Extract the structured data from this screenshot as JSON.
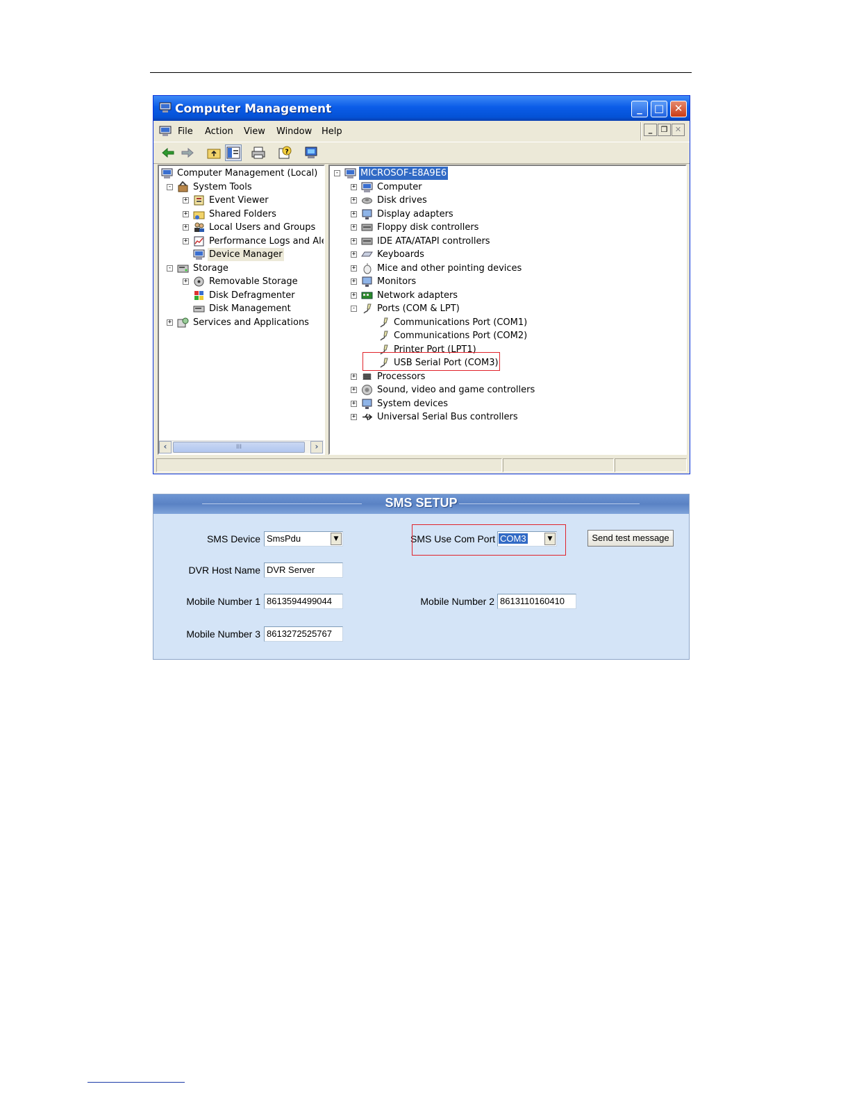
{
  "window": {
    "title": "Computer Management",
    "menu": [
      "File",
      "Action",
      "View",
      "Window",
      "Help"
    ],
    "title_buttons": {
      "minimize": "_",
      "maximize": "□",
      "close": "✕"
    },
    "mdi_buttons": {
      "minimize": "_",
      "restore": "❐",
      "close": "✕"
    },
    "scroll_thumb": "III"
  },
  "left_tree": [
    {
      "label": "Computer Management (Local)",
      "icon": "computer-management-icon",
      "level": 0,
      "expander": ""
    },
    {
      "label": "System Tools",
      "icon": "system-tools-icon",
      "level": 1,
      "expander": "-"
    },
    {
      "label": "Event Viewer",
      "icon": "event-viewer-icon",
      "level": 2,
      "expander": "+"
    },
    {
      "label": "Shared Folders",
      "icon": "shared-folders-icon",
      "level": 2,
      "expander": "+"
    },
    {
      "label": "Local Users and Groups",
      "icon": "users-icon",
      "level": 2,
      "expander": "+"
    },
    {
      "label": "Performance Logs and Alerts",
      "icon": "performance-icon",
      "level": 2,
      "expander": "+"
    },
    {
      "label": "Device Manager",
      "icon": "device-manager-icon",
      "level": 2,
      "expander": "",
      "highlight": true
    },
    {
      "label": "Storage",
      "icon": "storage-icon",
      "level": 1,
      "expander": "-"
    },
    {
      "label": "Removable Storage",
      "icon": "removable-storage-icon",
      "level": 2,
      "expander": "+"
    },
    {
      "label": "Disk Defragmenter",
      "icon": "defragmenter-icon",
      "level": 2,
      "expander": ""
    },
    {
      "label": "Disk Management",
      "icon": "disk-management-icon",
      "level": 2,
      "expander": ""
    },
    {
      "label": "Services and Applications",
      "icon": "services-icon",
      "level": 1,
      "expander": "+"
    }
  ],
  "right_tree": [
    {
      "label": "MICROSOF-E8A9E6",
      "icon": "computer-icon",
      "level": 0,
      "expander": "-",
      "selected": true
    },
    {
      "label": "Computer",
      "icon": "computer-icon",
      "level": 1,
      "expander": "+"
    },
    {
      "label": "Disk drives",
      "icon": "disk-drive-icon",
      "level": 1,
      "expander": "+"
    },
    {
      "label": "Display adapters",
      "icon": "display-adapter-icon",
      "level": 1,
      "expander": "+"
    },
    {
      "label": "Floppy disk controllers",
      "icon": "floppy-controller-icon",
      "level": 1,
      "expander": "+"
    },
    {
      "label": "IDE ATA/ATAPI controllers",
      "icon": "ide-controller-icon",
      "level": 1,
      "expander": "+"
    },
    {
      "label": "Keyboards",
      "icon": "keyboard-icon",
      "level": 1,
      "expander": "+"
    },
    {
      "label": "Mice and other pointing devices",
      "icon": "mouse-icon",
      "level": 1,
      "expander": "+"
    },
    {
      "label": "Monitors",
      "icon": "monitor-icon",
      "level": 1,
      "expander": "+"
    },
    {
      "label": "Network adapters",
      "icon": "network-adapter-icon",
      "level": 1,
      "expander": "+"
    },
    {
      "label": "Ports (COM & LPT)",
      "icon": "port-icon",
      "level": 1,
      "expander": "-"
    },
    {
      "label": "Communications Port (COM1)",
      "icon": "port-icon",
      "level": 2,
      "expander": ""
    },
    {
      "label": "Communications Port (COM2)",
      "icon": "port-icon",
      "level": 2,
      "expander": ""
    },
    {
      "label": "Printer Port (LPT1)",
      "icon": "port-icon",
      "level": 2,
      "expander": ""
    },
    {
      "label": "USB Serial Port (COM3)",
      "icon": "port-icon",
      "level": 2,
      "expander": "",
      "boxed": true
    },
    {
      "label": "Processors",
      "icon": "processor-icon",
      "level": 1,
      "expander": "+"
    },
    {
      "label": "Sound, video and game controllers",
      "icon": "sound-icon",
      "level": 1,
      "expander": "+"
    },
    {
      "label": "System devices",
      "icon": "system-devices-icon",
      "level": 1,
      "expander": "+"
    },
    {
      "label": "Universal Serial Bus controllers",
      "icon": "usb-icon",
      "level": 1,
      "expander": "+"
    }
  ],
  "sms": {
    "title": "SMS SETUP",
    "device_label": "SMS Device",
    "device_value": "SmsPdu",
    "com_label": "SMS Use Com Port",
    "com_value": "COM3",
    "test_button": "Send test message",
    "host_label": "DVR Host Name",
    "host_value": "DVR Server",
    "mobile1_label": "Mobile Number 1",
    "mobile1_value": "8613594499044",
    "mobile2_label": "Mobile Number 2",
    "mobile2_value": "8613110160410",
    "mobile3_label": "Mobile Number 3",
    "mobile3_value": "8613272525767",
    "dropdown_arrow": "▼"
  },
  "colors": {
    "accent_red": "#e0222a",
    "selection": "#316ac5",
    "xp_title": "#0b5ce8",
    "sms_bg": "#d4e4f7"
  }
}
